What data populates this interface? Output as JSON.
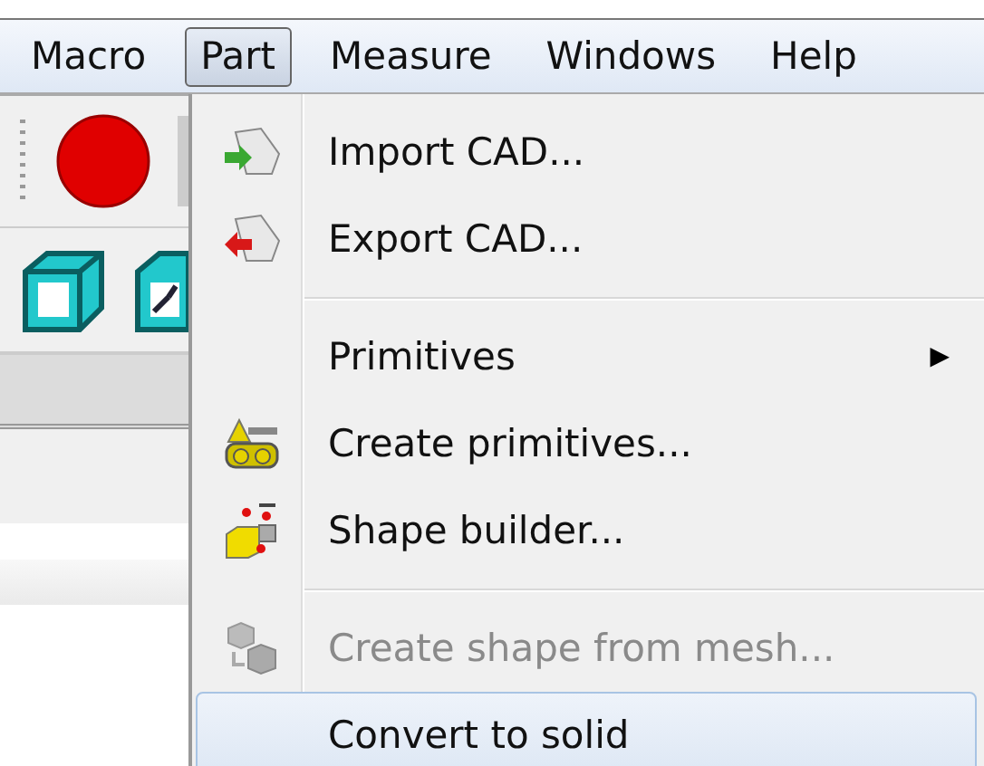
{
  "menubar": [
    {
      "label": "Macro",
      "selected": false
    },
    {
      "label": "Part",
      "selected": true
    },
    {
      "label": "Measure",
      "selected": false
    },
    {
      "label": "Windows",
      "selected": false
    },
    {
      "label": "Help",
      "selected": false
    }
  ],
  "dropdown": [
    {
      "kind": "item",
      "label": "Import CAD...",
      "disabled": false,
      "highlighted": false
    },
    {
      "kind": "item",
      "label": "Export CAD...",
      "disabled": false,
      "highlighted": false
    },
    {
      "kind": "separator"
    },
    {
      "kind": "submenu",
      "label": "Primitives",
      "arrow": "▶",
      "disabled": false,
      "highlighted": false
    },
    {
      "kind": "item",
      "label": "Create primitives...",
      "disabled": false,
      "highlighted": false
    },
    {
      "kind": "item",
      "label": "Shape builder...",
      "disabled": false,
      "highlighted": false
    },
    {
      "kind": "separator"
    },
    {
      "kind": "item",
      "label": "Create shape from mesh...",
      "disabled": true,
      "highlighted": false
    },
    {
      "kind": "item",
      "label": "Convert to solid",
      "disabled": false,
      "highlighted": true
    }
  ]
}
